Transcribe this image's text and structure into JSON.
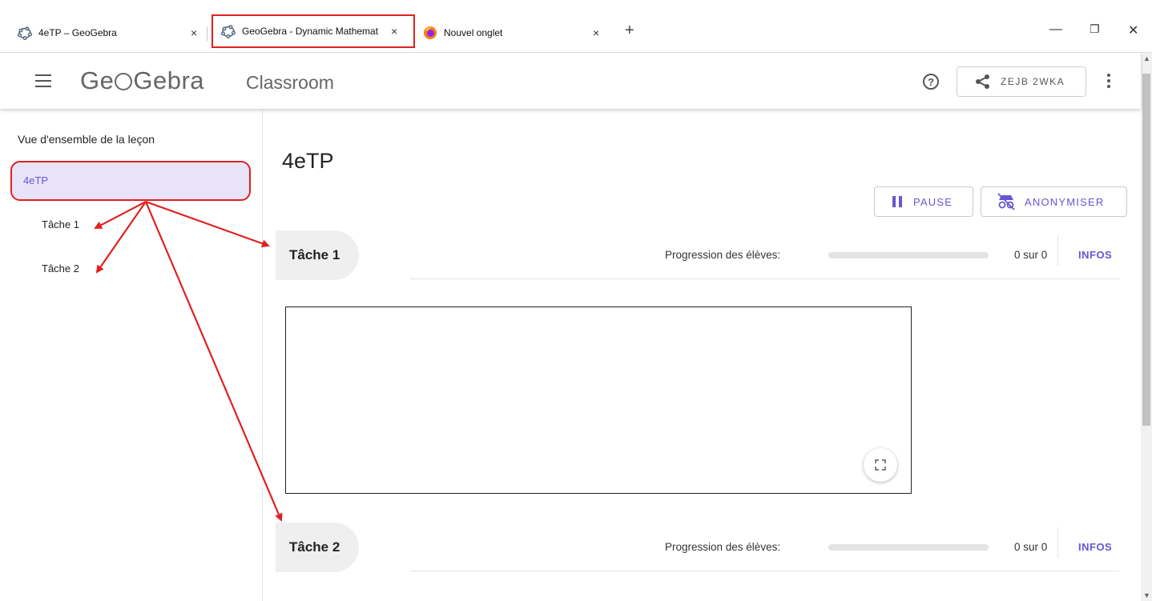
{
  "browser": {
    "tabs": [
      {
        "label": "4eTP – GeoGebra",
        "close": "×",
        "icon": "geogebra-icon"
      },
      {
        "label": "GeoGebra - Dynamic Mathemat",
        "close": "×",
        "icon": "geogebra-icon",
        "active": true
      },
      {
        "label": "Nouvel onglet",
        "close": "×",
        "icon": "firefox-icon"
      }
    ],
    "new_tab": "+",
    "window_controls": {
      "minimize": "—",
      "restore": "❐",
      "close": "✕"
    }
  },
  "header": {
    "logo_pre": "Ge",
    "logo_post": "Gebra",
    "product": "Classroom",
    "help": "?",
    "share_code": "ZEJB 2WKA"
  },
  "sidebar": {
    "overview": "Vue d'ensemble de la leçon",
    "lesson": "4eTP",
    "tasks": [
      "Tâche 1",
      "Tâche 2"
    ]
  },
  "main": {
    "title": "4eTP",
    "pause_label": "PAUSE",
    "anonymize_label": "ANONYMISER",
    "tasks": [
      {
        "name": "Tâche 1",
        "progress_label": "Progression des élèves:",
        "progress_fraction": 0,
        "count": "0 sur 0",
        "infos": "INFOS"
      },
      {
        "name": "Tâche 2",
        "progress_label": "Progression des élèves:",
        "progress_fraction": 0,
        "count": "0 sur 0",
        "infos": "INFOS"
      }
    ]
  },
  "colors": {
    "accent": "#6557d2",
    "highlight_border": "#e12020",
    "selected_bg": "#e8e3f8",
    "arrow": "#e12020"
  }
}
